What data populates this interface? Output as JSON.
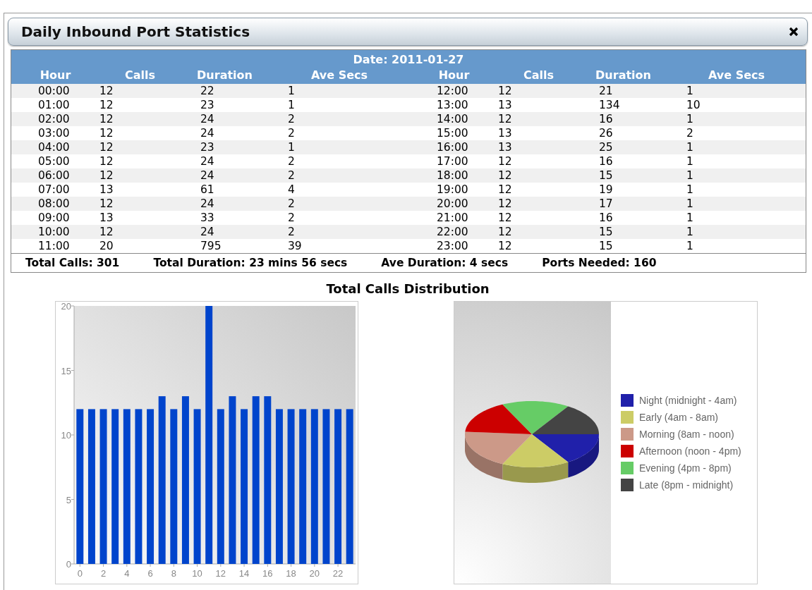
{
  "window": {
    "title": "Daily Inbound Port Statistics"
  },
  "table": {
    "date": "Date: 2011-01-27",
    "columns": [
      "Hour",
      "Calls",
      "Duration",
      "Ave Secs",
      "Hour",
      "Calls",
      "Duration",
      "Ave Secs"
    ],
    "rows": [
      [
        "00:00",
        "12",
        "22",
        "1",
        "12:00",
        "12",
        "21",
        "1"
      ],
      [
        "01:00",
        "12",
        "23",
        "1",
        "13:00",
        "13",
        "134",
        "10"
      ],
      [
        "02:00",
        "12",
        "24",
        "2",
        "14:00",
        "12",
        "16",
        "1"
      ],
      [
        "03:00",
        "12",
        "24",
        "2",
        "15:00",
        "13",
        "26",
        "2"
      ],
      [
        "04:00",
        "12",
        "23",
        "1",
        "16:00",
        "13",
        "25",
        "1"
      ],
      [
        "05:00",
        "12",
        "24",
        "2",
        "17:00",
        "12",
        "16",
        "1"
      ],
      [
        "06:00",
        "12",
        "24",
        "2",
        "18:00",
        "12",
        "15",
        "1"
      ],
      [
        "07:00",
        "13",
        "61",
        "4",
        "19:00",
        "12",
        "19",
        "1"
      ],
      [
        "08:00",
        "12",
        "24",
        "2",
        "20:00",
        "12",
        "17",
        "1"
      ],
      [
        "09:00",
        "13",
        "33",
        "2",
        "21:00",
        "12",
        "16",
        "1"
      ],
      [
        "10:00",
        "12",
        "24",
        "2",
        "22:00",
        "12",
        "15",
        "1"
      ],
      [
        "11:00",
        "20",
        "795",
        "39",
        "23:00",
        "12",
        "15",
        "1"
      ]
    ]
  },
  "totals": [
    "Total Calls: 301",
    "Total Duration: 23 mins 56 secs",
    "Ave Duration: 4 secs",
    "Ports Needed: 160"
  ],
  "distribution": {
    "title": "Total Calls Distribution",
    "bar_chart": {
      "chart_data": {
        "type": "bar",
        "x": [
          0,
          1,
          2,
          3,
          4,
          5,
          6,
          7,
          8,
          9,
          10,
          11,
          12,
          13,
          14,
          15,
          16,
          17,
          18,
          19,
          20,
          21,
          22,
          23
        ],
        "xlim": [
          -0.5,
          23.5
        ],
        "values": [
          12,
          12,
          12,
          12,
          12,
          12,
          12,
          13,
          12,
          13,
          12,
          20,
          12,
          13,
          12,
          13,
          13,
          12,
          12,
          12,
          12,
          12,
          12,
          12
        ],
        "ylim": [
          0,
          20
        ],
        "yticks": [
          0,
          5,
          10,
          15,
          20
        ],
        "xticks": [
          0,
          2,
          4,
          6,
          8,
          10,
          12,
          14,
          16,
          18,
          20,
          22
        ],
        "color": "#0044cc"
      }
    },
    "pie_chart": {
      "legend": [
        {
          "label": "Night (midnight - 4am)",
          "color": "#2020aa"
        },
        {
          "label": "Early (4am - 8am)",
          "color": "#cccc66"
        },
        {
          "label": "Morning (8am - noon)",
          "color": "#cc9988"
        },
        {
          "label": "Afternoon (noon - 4pm)",
          "color": "#cc0000"
        },
        {
          "label": "Evening (4pm - 8pm)",
          "color": "#66cc66"
        },
        {
          "label": "Late (8pm - midnight)",
          "color": "#444444"
        }
      ]
    }
  }
}
